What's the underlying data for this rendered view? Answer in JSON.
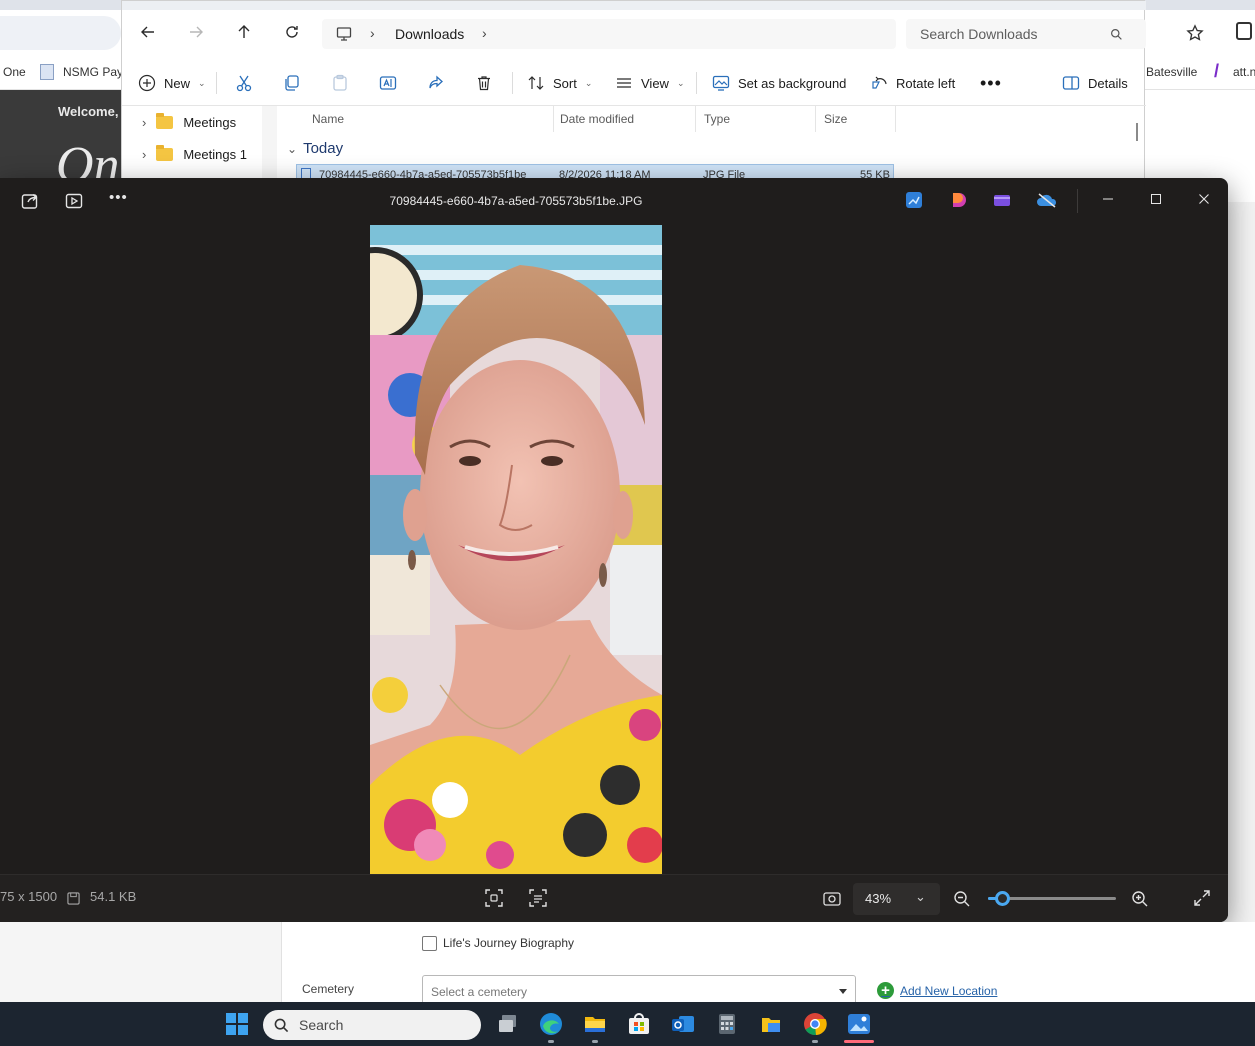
{
  "browser": {
    "bookmarks": [
      "One",
      "NSMG Pay",
      "Batesville",
      "att.n"
    ],
    "page_welcome": "Welcome,",
    "page_heading_fragment": "On"
  },
  "explorer": {
    "address_current": "Downloads",
    "search_placeholder": "Search Downloads",
    "toolbar": {
      "new_label": "New",
      "sort_label": "Sort",
      "view_label": "View",
      "set_background_label": "Set as background",
      "rotate_left_label": "Rotate left",
      "details_label": "Details"
    },
    "sidebar": [
      {
        "label": "Meetings"
      },
      {
        "label": "Meetings 1"
      }
    ],
    "columns": [
      "Name",
      "Date modified",
      "Type",
      "Size"
    ],
    "group_label": "Today",
    "file_row": {
      "name": "70984445-e660-4b7a-a5ed-705573b5f1be",
      "date": "8/2/2026 11:18 AM",
      "type": "JPG File",
      "size": "55 KB"
    }
  },
  "photos": {
    "filename": "70984445-e660-4b7a-a5ed-705573b5f1be.JPG",
    "dimensions": "75 x 1500",
    "file_size": "54.1 KB",
    "zoom": "43%",
    "zoom_fraction": 0.11
  },
  "form": {
    "checkbox_label": "Life's Journey Biography",
    "cemetery_label": "Cemetery",
    "cemetery_placeholder": "Select a cemetery",
    "add_location_label": "Add New Location"
  },
  "taskbar": {
    "search_label": "Search"
  },
  "colors": {
    "viewer_bg": "#1f1d1c",
    "accent": "#4aa8f0",
    "taskbar_bg": "#1c2530"
  }
}
